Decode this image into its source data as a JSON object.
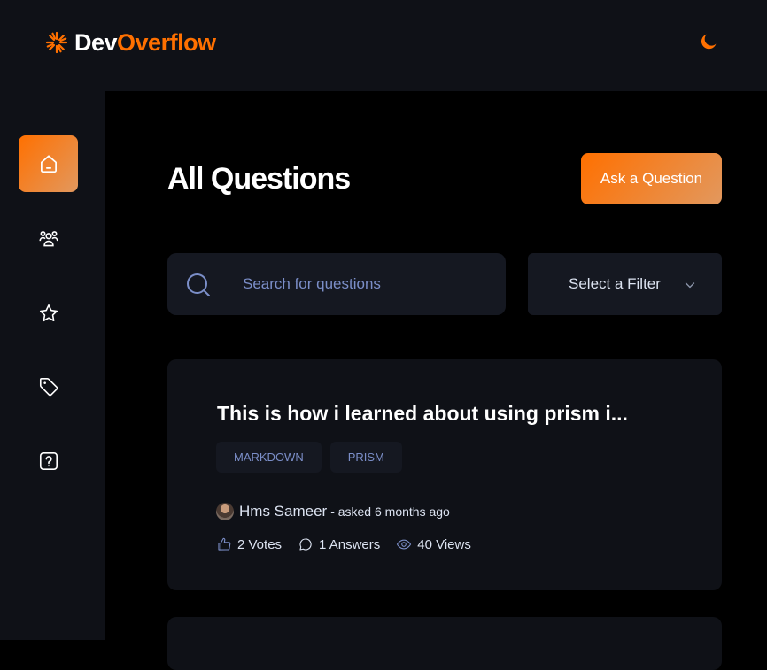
{
  "navbar": {
    "logo_dev": "Dev",
    "logo_overflow": "Overflow"
  },
  "colors": {
    "accent": "#ff7000",
    "accent_light": "#e2985e",
    "sidebar_bg": "#0f1117",
    "card_bg": "#0f1117",
    "input_bg": "#151821",
    "tag_text": "#7b8ec8"
  },
  "sidebar": {
    "items": [
      {
        "icon": "home-icon",
        "active": true
      },
      {
        "icon": "users-icon",
        "active": false
      },
      {
        "icon": "star-icon",
        "active": false
      },
      {
        "icon": "tag-icon",
        "active": false
      },
      {
        "icon": "question-icon",
        "active": false
      }
    ]
  },
  "main": {
    "title": "All Questions",
    "ask_button": "Ask a Question",
    "search": {
      "placeholder": "Search for questions"
    },
    "filter": {
      "label": "Select a Filter"
    }
  },
  "questions": [
    {
      "title": "This is how i learned about using prism i...",
      "tags": [
        "MARKDOWN",
        "PRISM"
      ],
      "author": "Hms Sameer",
      "asked": "- asked 6 months ago",
      "votes": "2 Votes",
      "answers": "1 Answers",
      "views": "40 Views"
    }
  ]
}
